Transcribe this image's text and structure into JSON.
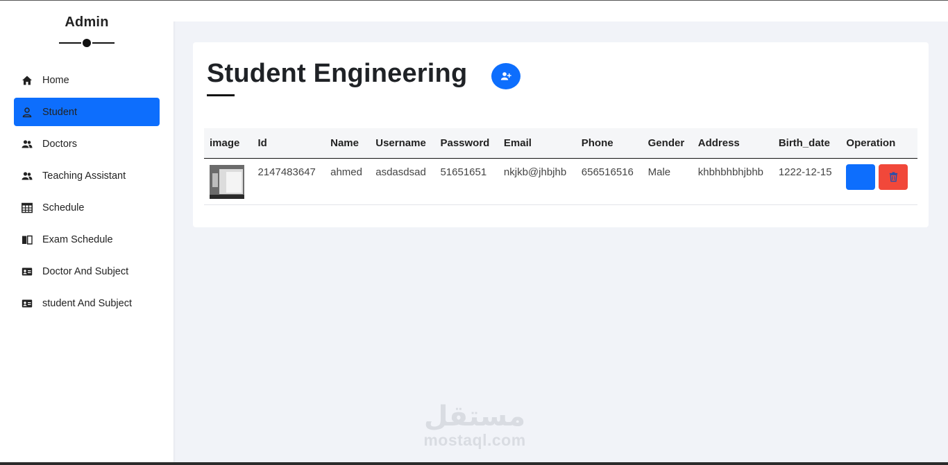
{
  "sidebar": {
    "title": "Admin",
    "items": [
      {
        "label": "Home",
        "icon": "home-icon",
        "active": false
      },
      {
        "label": "Student",
        "icon": "user-icon",
        "active": true
      },
      {
        "label": "Doctors",
        "icon": "users-icon",
        "active": false
      },
      {
        "label": "Teaching Assistant",
        "icon": "users-icon",
        "active": false
      },
      {
        "label": "Schedule",
        "icon": "table-icon",
        "active": false
      },
      {
        "label": "Exam Schedule",
        "icon": "book-icon",
        "active": false
      },
      {
        "label": "Doctor And Subject",
        "icon": "id-card-icon",
        "active": false
      },
      {
        "label": "student And Subject",
        "icon": "id-card-icon",
        "active": false
      }
    ]
  },
  "main": {
    "title": "Student Engineering",
    "add_button_icon": "user-plus-icon",
    "table": {
      "headers": [
        "image",
        "Id",
        "Name",
        "Username",
        "Password",
        "Email",
        "Phone",
        "Gender",
        "Address",
        "Birth_date",
        "Operation"
      ],
      "rows": [
        {
          "id": "2147483647",
          "name": "ahmed",
          "username": "asdasdsad",
          "password": "51651651",
          "email": "nkjkb@jhbjhb",
          "phone": "656516516",
          "gender": "Male",
          "address": "khbhbhbhjbhb",
          "birth_date": "1222-12-15"
        }
      ]
    }
  },
  "watermark": {
    "arabic": "مستقل",
    "latin": "mostaql.com"
  },
  "colors": {
    "primary": "#0d6efd",
    "danger": "#f1483a",
    "background": "#f1f3f8"
  }
}
